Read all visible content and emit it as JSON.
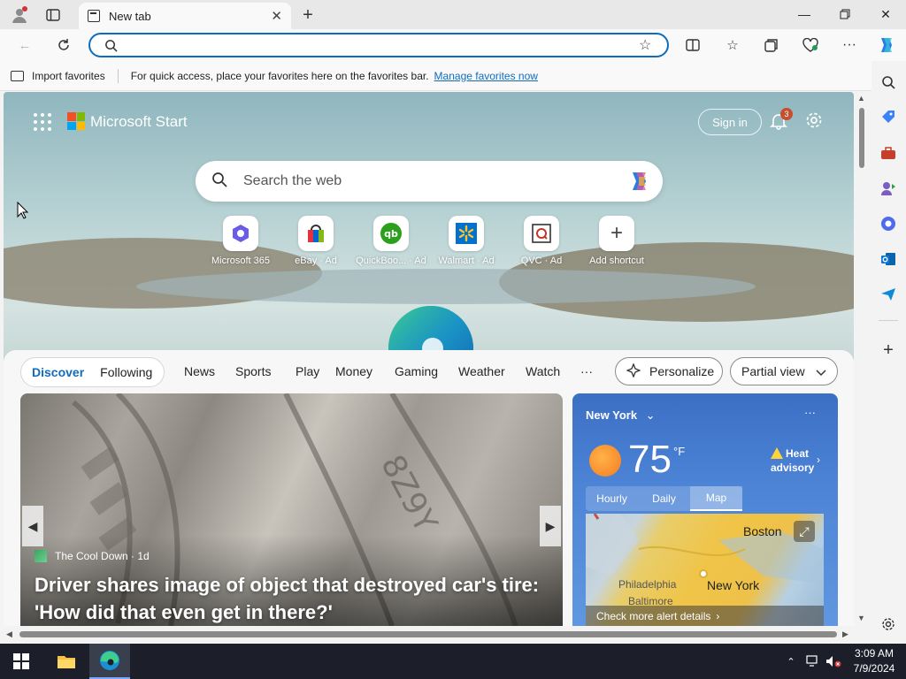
{
  "browser": {
    "tab_title": "New tab",
    "address_value": "",
    "favorites_bar": {
      "import_label": "Import favorites",
      "message": "For quick access, place your favorites here on the favorites bar.",
      "manage_link": "Manage favorites now"
    }
  },
  "start_page": {
    "brand": "Microsoft Start",
    "sign_in": "Sign in",
    "notifications_count": "3",
    "search_placeholder": "Search the web",
    "quick_links": [
      {
        "label": "Microsoft 365",
        "icon": "microsoft-365-icon"
      },
      {
        "label": "eBay · Ad",
        "icon": "ebay-icon"
      },
      {
        "label": "QuickBoo... · Ad",
        "icon": "quickbooks-icon"
      },
      {
        "label": "Walmart · Ad",
        "icon": "walmart-icon"
      },
      {
        "label": "QVC · Ad",
        "icon": "qvc-icon"
      },
      {
        "label": "Add shortcut",
        "icon": "plus-icon"
      }
    ]
  },
  "feed": {
    "primary_tabs": [
      "Discover",
      "Following"
    ],
    "nav_tabs": [
      "News",
      "Sports",
      "Play",
      "Money",
      "Gaming",
      "Weather",
      "Watch"
    ],
    "more_label": "···",
    "personalize_label": "Personalize",
    "view_label": "Partial view",
    "hero_card": {
      "source": "The Cool Down · 1d",
      "title": "Driver shares image of object that destroyed car's tire: 'How did that even get in there?'"
    },
    "weather": {
      "city": "New York",
      "temperature": "75",
      "unit": "°F",
      "alert": "Heat advisory",
      "tabs": [
        "Hourly",
        "Daily",
        "Map"
      ],
      "active_tab": "Map",
      "map_labels": {
        "boston": "Boston",
        "philadelphia": "Philadelphia",
        "baltimore": "Baltimore",
        "new_york": "New York"
      },
      "map_footer": "Check more alert details"
    }
  },
  "taskbar": {
    "time": "3:09 AM",
    "date": "7/9/2024"
  },
  "colors": {
    "accent": "#0f6cbd",
    "weather_bg": "#4d84d6",
    "taskbar": "#1c1f2a"
  }
}
